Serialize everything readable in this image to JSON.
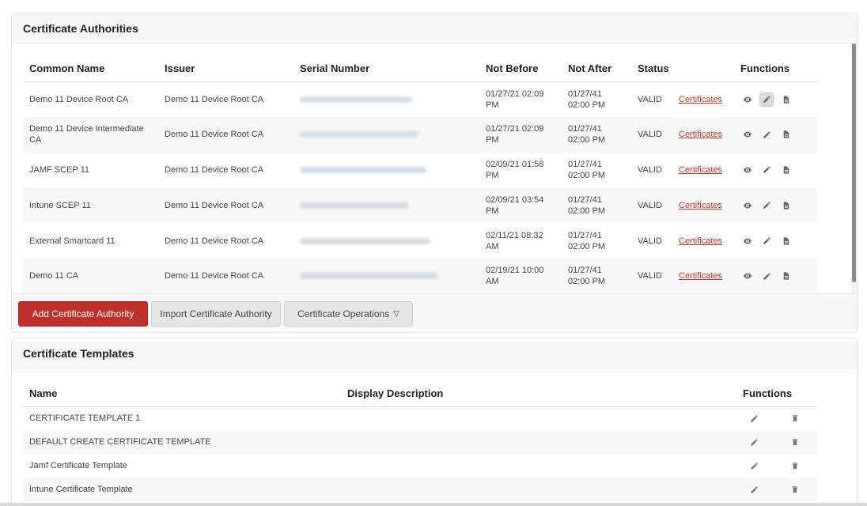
{
  "ca_panel": {
    "title": "Certificate Authorities",
    "columns": {
      "common_name": "Common Name",
      "issuer": "Issuer",
      "serial_number": "Serial Number",
      "not_before": "Not Before",
      "not_after": "Not After",
      "status": "Status",
      "functions": "Functions"
    },
    "rows": [
      {
        "common_name": "Demo 11 Device Root CA",
        "issuer": "Demo 11 Device Root CA",
        "not_before": "01/27/21 02:09 PM",
        "not_after": "01/27/41 02:00 PM",
        "status": "VALID",
        "certificates_link": "Certificates"
      },
      {
        "common_name": "Demo 11 Device Intermediate CA",
        "issuer": "Demo 11 Device Root CA",
        "not_before": "01/27/21 02:09 PM",
        "not_after": "01/27/41 02:00 PM",
        "status": "VALID",
        "certificates_link": "Certificates"
      },
      {
        "common_name": "JAMF SCEP 11",
        "issuer": "Demo 11 Device Root CA",
        "not_before": "02/09/21 01:58 PM",
        "not_after": "01/27/41 02:00 PM",
        "status": "VALID",
        "certificates_link": "Certificates"
      },
      {
        "common_name": "Intune SCEP 11",
        "issuer": "Demo 11 Device Root CA",
        "not_before": "02/09/21 03:54 PM",
        "not_after": "01/27/41 02:00 PM",
        "status": "VALID",
        "certificates_link": "Certificates"
      },
      {
        "common_name": "External Smartcard 11",
        "issuer": "Demo 11 Device Root CA",
        "not_before": "02/11/21 08:32 AM",
        "not_after": "01/27/41 02:00 PM",
        "status": "VALID",
        "certificates_link": "Certificates"
      },
      {
        "common_name": "Demo 11 CA",
        "issuer": "Demo 11 Device Root CA",
        "not_before": "02/19/21 10:00 AM",
        "not_after": "01/27/41 02:00 PM",
        "status": "VALID",
        "certificates_link": "Certificates"
      }
    ],
    "buttons": {
      "add": "Add Certificate Authority",
      "import": "Import Certificate Authority",
      "operations": "Certificate Operations"
    },
    "icons": [
      "eye-icon",
      "pencil-icon",
      "document-icon",
      "caret-down-icon"
    ]
  },
  "tpl_panel": {
    "title": "Certificate Templates",
    "columns": {
      "name": "Name",
      "display_description": "Display Description",
      "functions": "Functions"
    },
    "rows": [
      {
        "name": "CERTIFICATE TEMPLATE 1",
        "display_description": ""
      },
      {
        "name": "DEFAULT CREATE CERTIFICATE TEMPLATE",
        "display_description": ""
      },
      {
        "name": "Jamf Certificate Template",
        "display_description": ""
      },
      {
        "name": "Intune Certificate Template",
        "display_description": ""
      }
    ],
    "icons": [
      "pencil-icon",
      "trash-icon"
    ]
  },
  "colors": {
    "primary_button": "#c0302a",
    "link": "#c0392b",
    "panel_header": "#f7f7f7"
  }
}
